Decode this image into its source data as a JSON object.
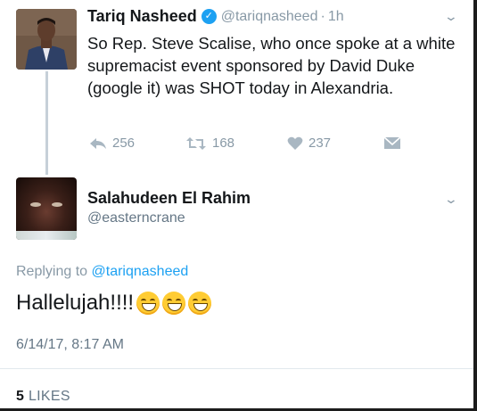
{
  "tweet1": {
    "name": "Tariq Nasheed",
    "handle": "@tariqnasheed",
    "separator": "·",
    "time": "1h",
    "text": "So Rep. Steve Scalise, who once spoke at a white supremacist event sponsored by David Duke (google it) was SHOT today in Alexandria.",
    "actions": {
      "replies": "256",
      "retweets": "168",
      "likes": "237"
    }
  },
  "tweet2": {
    "name": "Salahudeen El Rahim",
    "handle": "@easterncrane",
    "replying_prefix": "Replying to ",
    "replying_to": "@tariqnasheed",
    "text": "Hallelujah!!!!",
    "emoji_count": 3,
    "datetime": "6/14/17, 8:17 AM",
    "likes_count": "5",
    "likes_label": "LIKES"
  },
  "icons": {
    "verified": "verified-badge-icon",
    "reply": "reply-icon",
    "retweet": "retweet-icon",
    "like": "heart-icon",
    "message": "envelope-icon",
    "menu": "chevron-down-icon"
  },
  "colors": {
    "accent": "#1da1f2",
    "muted": "#8899a6",
    "text": "#14171a",
    "thread_line": "#c6d0d8"
  }
}
